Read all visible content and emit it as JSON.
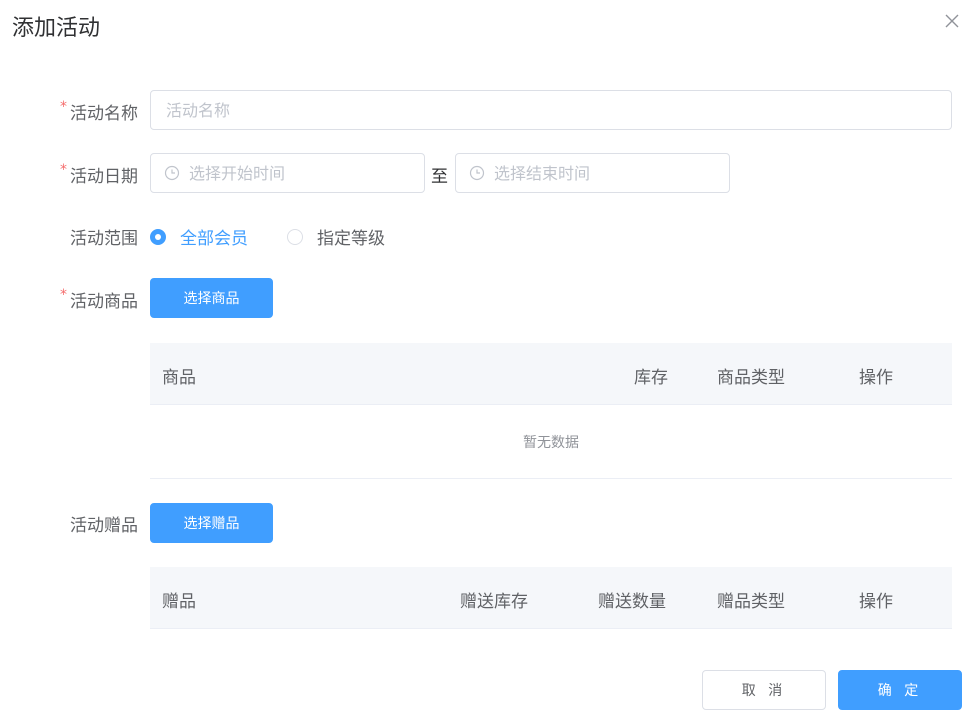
{
  "dialog": {
    "title": "添加活动"
  },
  "form": {
    "name": {
      "label": "活动名称",
      "required": "*",
      "placeholder": "活动名称",
      "value": ""
    },
    "date": {
      "label": "活动日期",
      "required": "*",
      "start_placeholder": "选择开始时间",
      "separator": "至",
      "end_placeholder": "选择结束时间"
    },
    "scope": {
      "label": "活动范围",
      "options": [
        {
          "label": "全部会员",
          "checked": true
        },
        {
          "label": "指定等级",
          "checked": false
        }
      ]
    },
    "products": {
      "label": "活动商品",
      "required": "*",
      "button": "选择商品",
      "columns": [
        "商品",
        "库存",
        "商品类型",
        "操作"
      ],
      "empty_text": "暂无数据"
    },
    "gifts": {
      "label": "活动赠品",
      "button": "选择赠品",
      "columns": [
        "赠品",
        "赠送库存",
        "赠送数量",
        "赠品类型",
        "操作"
      ]
    }
  },
  "footer": {
    "cancel": "取 消",
    "confirm": "确 定"
  },
  "colors": {
    "primary": "#409eff",
    "required": "#f56c6c",
    "header_bg": "#f5f7fa"
  },
  "icons": {
    "close": "close-icon",
    "clock": "clock-icon"
  }
}
